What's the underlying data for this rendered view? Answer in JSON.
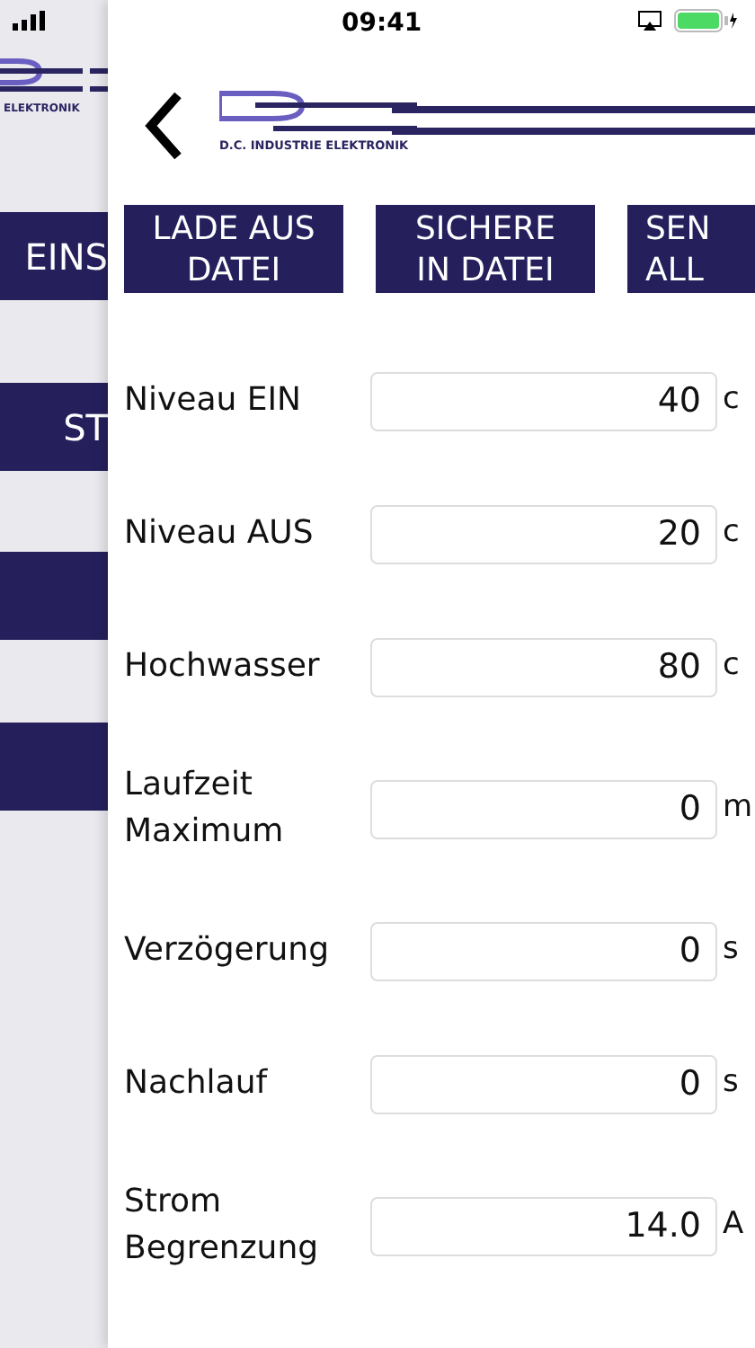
{
  "status_bar": {
    "time": "09:41"
  },
  "background": {
    "logo_caption": "ELEKTRONIK",
    "menu": [
      {
        "kind": "text",
        "label": "EINS"
      },
      {
        "kind": "text",
        "label": "ST"
      },
      {
        "kind": "blank"
      },
      {
        "kind": "blank"
      }
    ]
  },
  "header": {
    "logo_caption": "D.C. INDUSTRIE ELEKTRONIK"
  },
  "actions": [
    {
      "lines": [
        "LADE AUS",
        "DATEI"
      ]
    },
    {
      "lines": [
        "SICHERE",
        "IN DATEI"
      ]
    },
    {
      "lines": [
        "SEN",
        "ALL"
      ]
    }
  ],
  "fields": [
    {
      "label": "Niveau EIN",
      "value": "40",
      "unit": "c"
    },
    {
      "label": "Niveau AUS",
      "value": "20",
      "unit": "c"
    },
    {
      "label": "Hochwasser",
      "value": "80",
      "unit": "c"
    },
    {
      "label": "Laufzeit Maximum",
      "value": "0",
      "unit": "m"
    },
    {
      "label": "Verzögerung",
      "value": "0",
      "unit": "s"
    },
    {
      "label": "Nachlauf",
      "value": "0",
      "unit": "s"
    },
    {
      "label": "Strom Begrenzung",
      "value": "14.0",
      "unit": "A"
    }
  ]
}
